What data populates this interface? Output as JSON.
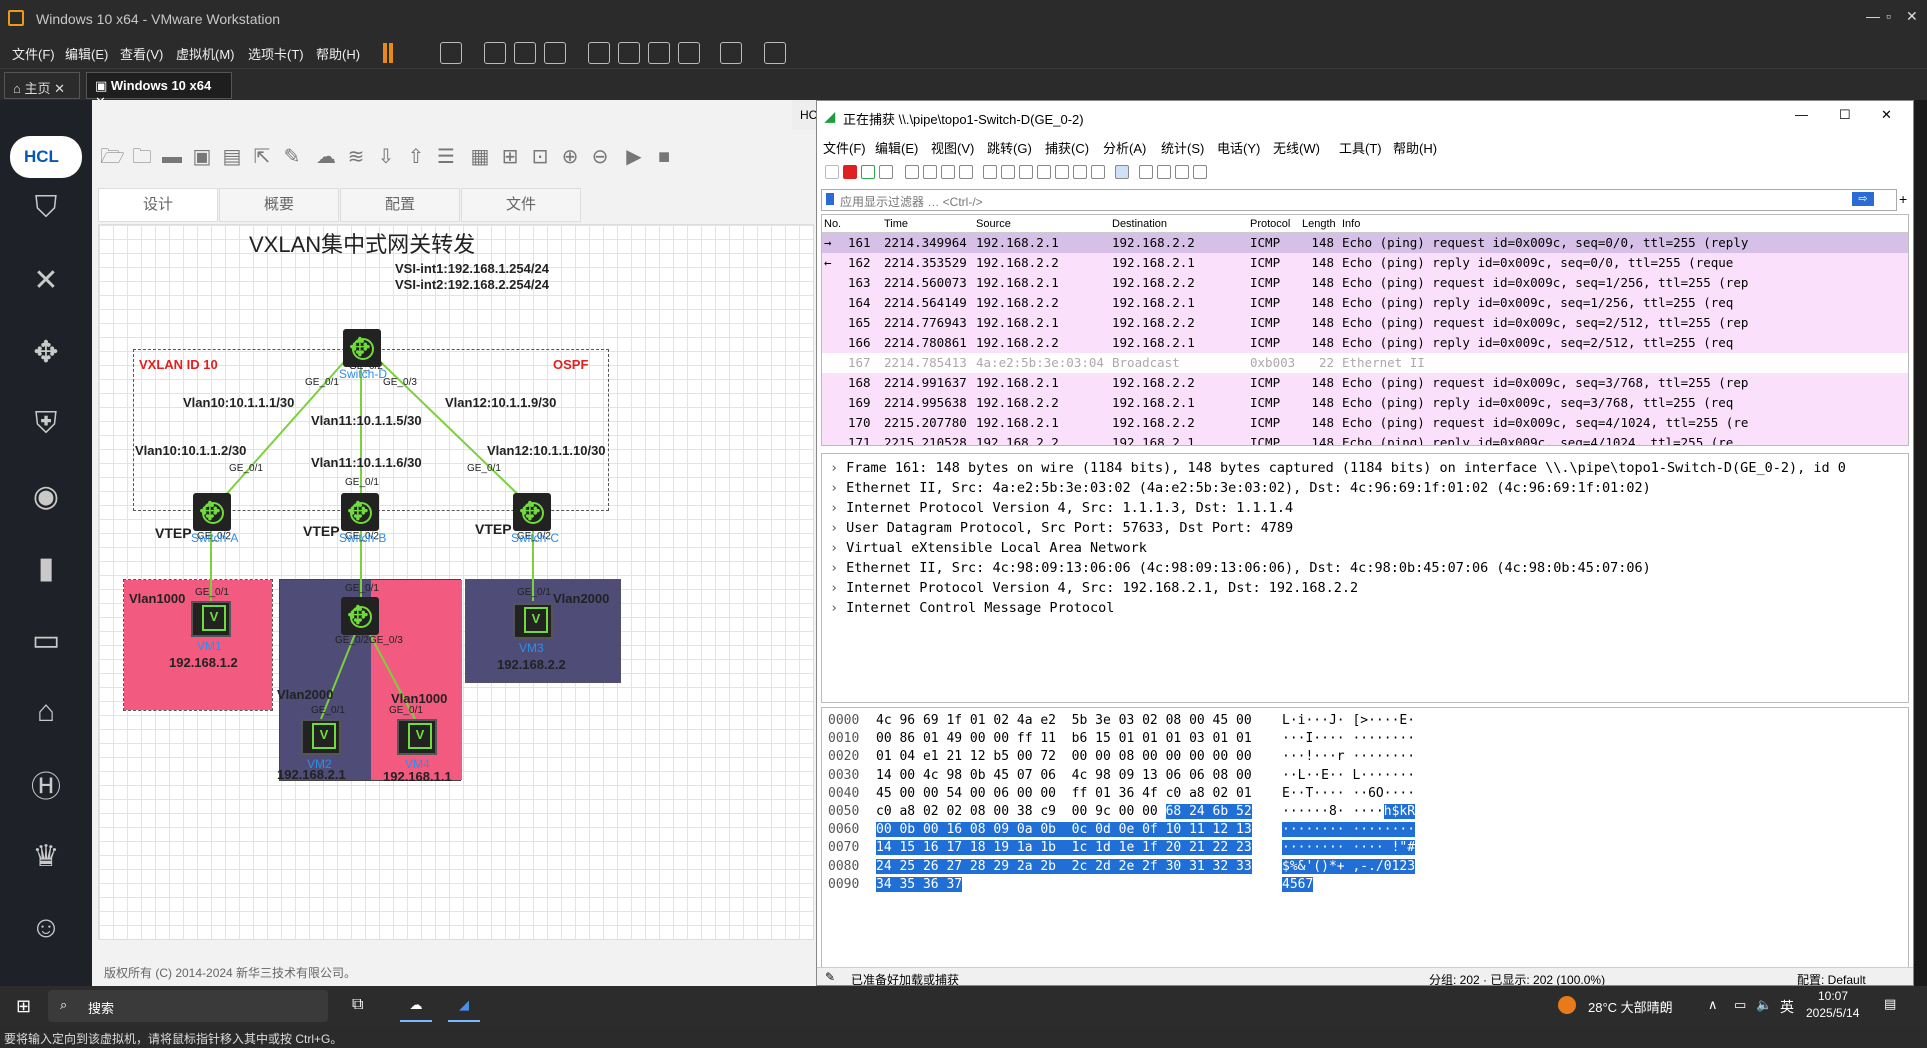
{
  "vmware": {
    "title": "Windows 10 x64 - VMware Workstation",
    "menu": [
      "文件(F)",
      "编辑(E)",
      "查看(V)",
      "虚拟机(M)",
      "选项卡(T)",
      "帮助(H)"
    ],
    "tabs": [
      {
        "label": "主页"
      },
      {
        "label": "Windows 10 x64"
      }
    ],
    "status_text": "要将输入定向到该虚拟机，请将鼠标指针移入其中或按 Ctrl+G。"
  },
  "hcl": {
    "logo": "HCL",
    "tabs": [
      "设计",
      "概要",
      "配置",
      "文件"
    ],
    "tab_strip_partial": "HC",
    "footer": "版权所有 (C) 2014-2024 新华三技术有限公司。",
    "topology": {
      "title": "VXLAN集中式网关转发",
      "vsi1": "VSI-int1:192.168.1.254/24",
      "vsi2": "VSI-int2:192.168.2.254/24",
      "vxlan_id": "VXLAN ID 10",
      "ospf": "OSPF",
      "links": {
        "l1": "Vlan10:10.1.1.1/30",
        "l2": "Vlan11:10.1.1.5/30",
        "l3": "Vlan12:10.1.1.9/30",
        "l4": "Vlan10:10.1.1.2/30",
        "l5": "Vlan11:10.1.1.6/30",
        "l6": "Vlan12:10.1.1.10/30"
      },
      "ports": {
        "ge01": "GE_0/1",
        "ge02": "GE_0/2",
        "ge03": "GE_0/3",
        "ge0203": "GE_0/2GE_0/3"
      },
      "vtep": "VTEP",
      "devices": {
        "sd": "Switch-D",
        "sa": "Switch-A",
        "sb": "Switch-B",
        "sc": "Switch-C",
        "vm1": "VM1",
        "vm2": "VM2",
        "vm3": "VM3",
        "vm4": "VM4"
      },
      "areas": {
        "vlan1000": "Vlan1000",
        "vlan2000": "Vlan2000"
      },
      "ips": {
        "vm1": "192.168.1.2",
        "vm3": "192.168.2.2",
        "vm2": "192.168.2.1",
        "vm4": "192.168.1.1"
      },
      "colors": {
        "pink": "#f35a80",
        "purple": "#4f4d78",
        "link": "#7ad13b"
      }
    }
  },
  "wireshark": {
    "title": "正在捕获 \\\\.\\pipe\\topo1-Switch-D(GE_0-2)",
    "menu": [
      "文件(F)",
      "编辑(E)",
      "视图(V)",
      "跳转(G)",
      "捕获(C)",
      "分析(A)",
      "统计(S)",
      "电话(Y)",
      "无线(W)",
      "工具(T)",
      "帮助(H)"
    ],
    "filter_placeholder": "应用显示过滤器 … <Ctrl-/>",
    "columns": [
      "No.",
      "Time",
      "Source",
      "Destination",
      "Protocol",
      "Length",
      "Info"
    ],
    "packets": [
      {
        "no": "161",
        "time": "2214.349964",
        "src": "192.168.2.1",
        "dst": "192.168.2.2",
        "proto": "ICMP",
        "len": "148",
        "info": "Echo (ping) request  id=0x009c, seq=0/0, ttl=255 (reply",
        "mark": "→"
      },
      {
        "no": "162",
        "time": "2214.353529",
        "src": "192.168.2.2",
        "dst": "192.168.2.1",
        "proto": "ICMP",
        "len": "148",
        "info": "Echo (ping) reply    id=0x009c, seq=0/0, ttl=255 (reque",
        "mark": "←"
      },
      {
        "no": "163",
        "time": "2214.560073",
        "src": "192.168.2.1",
        "dst": "192.168.2.2",
        "proto": "ICMP",
        "len": "148",
        "info": "Echo (ping) request  id=0x009c, seq=1/256, ttl=255 (rep",
        "mark": ""
      },
      {
        "no": "164",
        "time": "2214.564149",
        "src": "192.168.2.2",
        "dst": "192.168.2.1",
        "proto": "ICMP",
        "len": "148",
        "info": "Echo (ping) reply    id=0x009c, seq=1/256, ttl=255 (req",
        "mark": ""
      },
      {
        "no": "165",
        "time": "2214.776943",
        "src": "192.168.2.1",
        "dst": "192.168.2.2",
        "proto": "ICMP",
        "len": "148",
        "info": "Echo (ping) request  id=0x009c, seq=2/512, ttl=255 (rep",
        "mark": ""
      },
      {
        "no": "166",
        "time": "2214.780861",
        "src": "192.168.2.2",
        "dst": "192.168.2.1",
        "proto": "ICMP",
        "len": "148",
        "info": "Echo (ping) reply    id=0x009c, seq=2/512, ttl=255 (req",
        "mark": ""
      },
      {
        "no": "167",
        "time": "2214.785413",
        "src": "4a:e2:5b:3e:03:04",
        "dst": "Broadcast",
        "proto": "0xb003",
        "len": "22",
        "info": "Ethernet II",
        "mark": ""
      },
      {
        "no": "168",
        "time": "2214.991637",
        "src": "192.168.2.1",
        "dst": "192.168.2.2",
        "proto": "ICMP",
        "len": "148",
        "info": "Echo (ping) request  id=0x009c, seq=3/768, ttl=255 (rep",
        "mark": ""
      },
      {
        "no": "169",
        "time": "2214.995638",
        "src": "192.168.2.2",
        "dst": "192.168.2.1",
        "proto": "ICMP",
        "len": "148",
        "info": "Echo (ping) reply    id=0x009c, seq=3/768, ttl=255 (req",
        "mark": ""
      },
      {
        "no": "170",
        "time": "2215.207780",
        "src": "192.168.2.1",
        "dst": "192.168.2.2",
        "proto": "ICMP",
        "len": "148",
        "info": "Echo (ping) request  id=0x009c, seq=4/1024, ttl=255 (re",
        "mark": ""
      },
      {
        "no": "171",
        "time": "2215.210528",
        "src": "192.168.2.2",
        "dst": "192.168.2.1",
        "proto": "ICMP",
        "len": "148",
        "info": "Echo (ping) reply    id=0x009c, seq=4/1024, ttl=255 (re",
        "mark": ""
      }
    ],
    "details": [
      "Frame 161: 148 bytes on wire (1184 bits), 148 bytes captured (1184 bits) on interface \\\\.\\pipe\\topo1-Switch-D(GE_0-2), id 0",
      "Ethernet II, Src: 4a:e2:5b:3e:03:02 (4a:e2:5b:3e:03:02), Dst: 4c:96:69:1f:01:02 (4c:96:69:1f:01:02)",
      "Internet Protocol Version 4, Src: 1.1.1.3, Dst: 1.1.1.4",
      "User Datagram Protocol, Src Port: 57633, Dst Port: 4789",
      "Virtual eXtensible Local Area Network",
      "Ethernet II, Src: 4c:98:09:13:06:06 (4c:98:09:13:06:06), Dst: 4c:98:0b:45:07:06 (4c:98:0b:45:07:06)",
      "Internet Protocol Version 4, Src: 192.168.2.1, Dst: 192.168.2.2",
      "Internet Control Message Protocol"
    ],
    "bytes": [
      {
        "off": "0000",
        "hex": "4c 96 69 1f 01 02 4a e2  5b 3e 03 02 08 00 45 00",
        "hexhl": "",
        "asc": "L·i···J· [>····E·",
        "aschl": ""
      },
      {
        "off": "0010",
        "hex": "00 86 01 49 00 00 ff 11  b6 15 01 01 01 03 01 01",
        "hexhl": "",
        "asc": "···I···· ········",
        "aschl": ""
      },
      {
        "off": "0020",
        "hex": "01 04 e1 21 12 b5 00 72  00 00 08 00 00 00 00 00",
        "hexhl": "",
        "asc": "···!···r ········",
        "aschl": ""
      },
      {
        "off": "0030",
        "hex": "14 00 4c 98 0b 45 07 06  4c 98 09 13 06 06 08 00",
        "hexhl": "",
        "asc": "··L··E·· L·······",
        "aschl": ""
      },
      {
        "off": "0040",
        "hex": "45 00 00 54 00 06 00 00  ff 01 36 4f c0 a8 02 01",
        "hexhl": "",
        "asc": "E··T···· ··6O····",
        "aschl": ""
      },
      {
        "off": "0050",
        "hex": "c0 a8 02 02 08 00 38 c9  00 9c 00 00 ",
        "hexhl": "68 24 6b 52",
        "asc": "······8· ····",
        "aschl": "h$kR"
      },
      {
        "off": "0060",
        "hex": "",
        "hexhl": "00 0b 00 16 08 09 0a 0b  0c 0d 0e 0f 10 11 12 13",
        "asc": "",
        "aschl": "········ ········"
      },
      {
        "off": "0070",
        "hex": "",
        "hexhl": "14 15 16 17 18 19 1a 1b  1c 1d 1e 1f 20 21 22 23",
        "asc": "",
        "aschl": "········ ···· !\"#"
      },
      {
        "off": "0080",
        "hex": "",
        "hexhl": "24 25 26 27 28 29 2a 2b  2c 2d 2e 2f 30 31 32 33",
        "asc": "",
        "aschl": "$%&'()*+ ,-./0123"
      },
      {
        "off": "0090",
        "hex": "",
        "hexhl": "34 35 36 37",
        "asc": "",
        "aschl": "4567"
      }
    ],
    "status_left": "已准备好加载或捕获",
    "status_count": "分组: 202 · 已显示: 202 (100.0%)",
    "status_profile": "配置: Default"
  },
  "taskbar": {
    "search": "搜索",
    "weather": "28°C  大部晴朗",
    "lang": "英",
    "time": "10:07",
    "date": "2025/5/14"
  }
}
